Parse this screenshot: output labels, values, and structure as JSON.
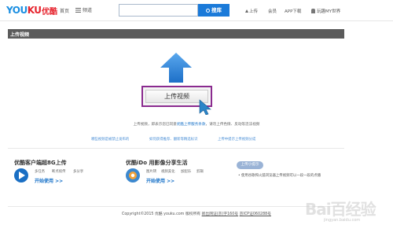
{
  "header": {
    "logo_text_y": "YOU",
    "logo_text_o": "KU",
    "logo_cn": "优酷",
    "home": "首页",
    "channel": "频道",
    "search_placeholder": "",
    "search_button": "搜库",
    "upload": "上传",
    "member": "会员",
    "app": "APP下载",
    "user": "玩趣MY世界"
  },
  "section": {
    "title": "上传视频"
  },
  "upload": {
    "button_label": "上传视频",
    "notice_prefix": "上传视频，即表示您已同意",
    "notice_link": "优酷上传服务条款",
    "notice_suffix": "，请勿上传色情、反动等违法视频"
  },
  "links": [
    "哪些视频是被禁止发布的",
    "如何获得推荐、翻新等精选标识",
    "上传中提示上传视频分成"
  ],
  "promos": {
    "client": {
      "title": "优酷客户端超8G上传",
      "features": [
        "多任务",
        "断点续传",
        "多分享"
      ],
      "start": "开始使用 >>"
    },
    "ido": {
      "title": "优酷iDo 用影像分享生活",
      "features": [
        "图片转",
        "视频美化",
        "加配乐",
        "剪辑"
      ],
      "start": "开始使用 >>"
    },
    "tip": {
      "badge": "上传小提示",
      "text": "使用谷歌和火狐浏览器上传视频可以一段一段的点播"
    }
  },
  "footer": {
    "copyright": "Copyright©2015 优酷 youku.com 版权所有",
    "link1": "新出网证(京)字160号",
    "link2": "京ICP证060288号"
  },
  "watermark": {
    "text": "Bai百经验",
    "sub": "jingyan.baidu.com"
  },
  "colors": {
    "brand_blue": "#1a8ee1",
    "brand_red": "#e6232d",
    "search_blue": "#1a7ad9",
    "highlight_purple": "#8a2b8f",
    "client_icon": "#1a6fc4",
    "ido_icon": "#3c88cf"
  },
  "icons": [
    "hamburger-icon",
    "search-icon",
    "upload-arrow-icon",
    "user-icon",
    "big-upload-arrow-icon",
    "cursor-pointer-icon",
    "play-icon",
    "ido-icon"
  ]
}
